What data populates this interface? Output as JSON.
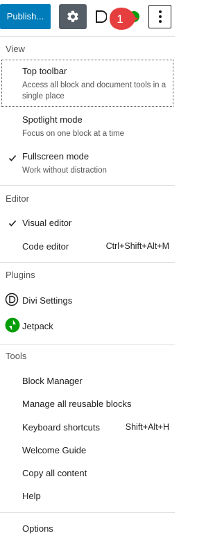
{
  "toolbar": {
    "publish_label": "Publish...",
    "badge_number": "1"
  },
  "menu": {
    "view": {
      "title": "View",
      "items": [
        {
          "label": "Top toolbar",
          "desc": "Access all block and document tools in a single place",
          "checked": false
        },
        {
          "label": "Spotlight mode",
          "desc": "Focus on one block at a time",
          "checked": false
        },
        {
          "label": "Fullscreen mode",
          "desc": "Work without distraction",
          "checked": true
        }
      ]
    },
    "editor": {
      "title": "Editor",
      "items": [
        {
          "label": "Visual editor",
          "shortcut": "",
          "checked": true
        },
        {
          "label": "Code editor",
          "shortcut": "Ctrl+Shift+Alt+M",
          "checked": false
        }
      ]
    },
    "plugins": {
      "title": "Plugins",
      "items": [
        {
          "label": "Divi Settings",
          "icon": "divi-icon"
        },
        {
          "label": "Jetpack",
          "icon": "jetpack-icon"
        }
      ]
    },
    "tools": {
      "title": "Tools",
      "items": [
        {
          "label": "Block Manager",
          "shortcut": ""
        },
        {
          "label": "Manage all reusable blocks",
          "shortcut": ""
        },
        {
          "label": "Keyboard shortcuts",
          "shortcut": "Shift+Alt+H"
        },
        {
          "label": "Welcome Guide",
          "shortcut": ""
        },
        {
          "label": "Copy all content",
          "shortcut": ""
        },
        {
          "label": "Help",
          "shortcut": ""
        }
      ]
    },
    "options": {
      "label": "Options"
    }
  },
  "colors": {
    "primary": "#007cba",
    "badge": "#e63e3e",
    "jetpack": "#069e08",
    "settings_bg": "#555d66"
  }
}
